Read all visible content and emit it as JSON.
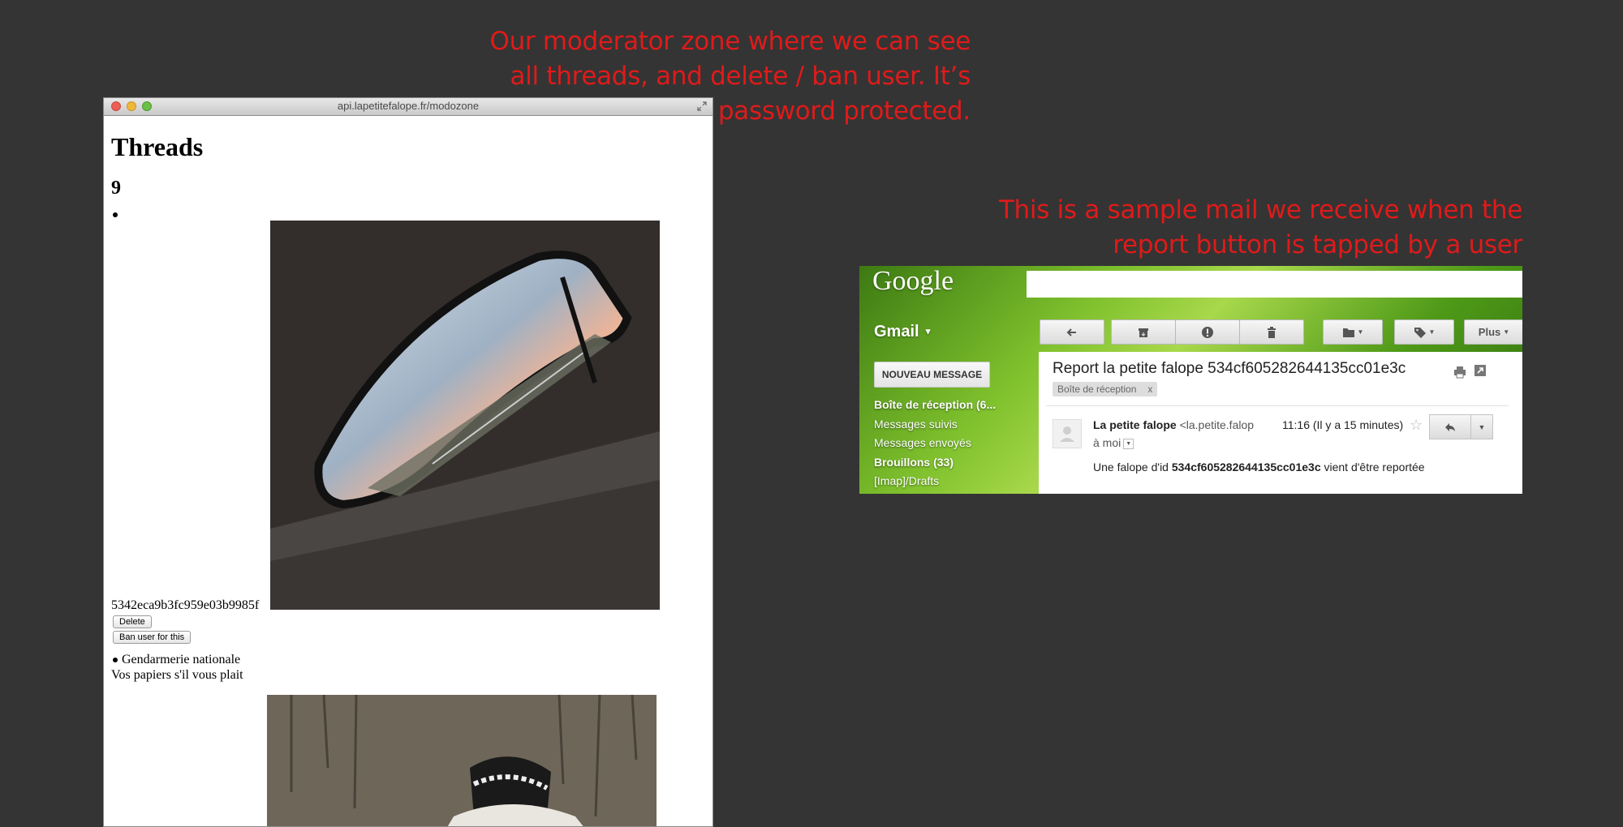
{
  "annotations": {
    "moderator_zone": "Our moderator zone where we can see all threads, and delete / ban user. It’s password protected.",
    "sample_mail": "This is a sample mail we receive  when the report button is tapped by a user"
  },
  "browser": {
    "url": "api.lapetitefalope.fr/modozone"
  },
  "modozone": {
    "heading": "Threads",
    "count": "9",
    "threads": [
      {
        "id": "5342eca9b3fc959e03b9985f",
        "delete_label": "Delete",
        "ban_label": "Ban user for this",
        "image": "car-window-sunset-photo"
      },
      {
        "title": "Gendarmerie nationale",
        "text": "Vos papiers s'il vous plait",
        "image": "gendarme-illustration-photo"
      }
    ]
  },
  "gmail": {
    "logo": "Google",
    "app_label": "Gmail",
    "compose_label": "NOUVEAU MESSAGE",
    "more_label": "Plus",
    "nav": [
      {
        "label": "Boîte de réception (6...",
        "bold": true
      },
      {
        "label": "Messages suivis",
        "bold": false
      },
      {
        "label": "Messages envoyés",
        "bold": false
      },
      {
        "label": "Brouillons (33)",
        "bold": true
      },
      {
        "label": "[Imap]/Drafts",
        "bold": false
      }
    ],
    "message": {
      "subject": "Report la petite falope 534cf605282644135cc01e3c",
      "label_tag": "Boîte de réception",
      "label_remove": "x",
      "sender_name": "La petite falope",
      "sender_email": "<la.petite.falop",
      "time": "11:16 (Il y a 15 minutes)",
      "to": "à moi",
      "body_prefix": "Une falope d'id ",
      "body_id": "534cf605282644135cc01e3c",
      "body_suffix": " vient d'être reportée"
    }
  }
}
